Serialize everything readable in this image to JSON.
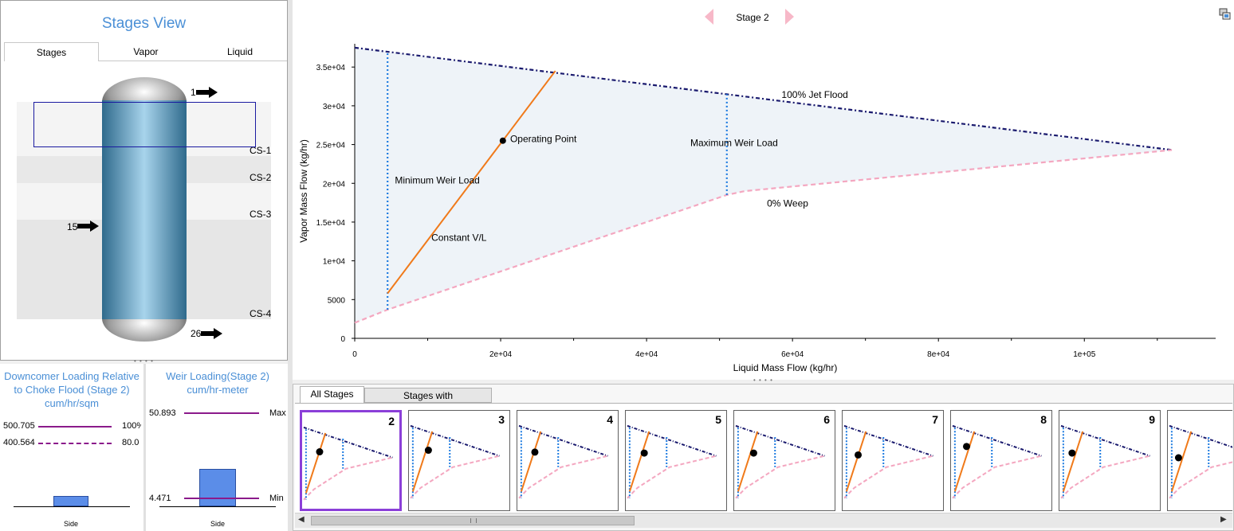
{
  "stages_view": {
    "title": "Stages View",
    "tabs": [
      "Stages",
      "Vapor",
      "Liquid"
    ],
    "active_tab": "Stages",
    "column_sections": [
      "CS-1",
      "CS-2",
      "CS-3",
      "CS-4"
    ],
    "streams": [
      "1",
      "15",
      "26"
    ]
  },
  "downcomer": {
    "title_line1": "Downcomer Loading Relative",
    "title_line2": "to Choke Flood (Stage 2)",
    "units": "cum/hr/sqm",
    "line1_value": "500.705",
    "line1_pct": "100%",
    "line2_value": "400.564",
    "line2_pct": "80.0",
    "bar_label": "Side"
  },
  "weir": {
    "title_line1": "Weir Loading(Stage 2)",
    "units": "cum/hr-meter",
    "max_value": "50.893",
    "max_label": "Max",
    "min_value": "4.471",
    "min_label": "Min",
    "bar_label": "Side"
  },
  "stage_nav": {
    "label": "Stage 2"
  },
  "chart_data": {
    "type": "line",
    "xlabel": "Liquid Mass Flow (kg/hr)",
    "ylabel": "Vapor Mass Flow (kg/hr)",
    "xlim": [
      0,
      118000
    ],
    "ylim": [
      0,
      38000
    ],
    "x_ticks": [
      0,
      20000,
      40000,
      60000,
      80000,
      100000
    ],
    "x_tick_labels": [
      "0",
      "2e+04",
      "4e+04",
      "6e+04",
      "8e+04",
      "1e+05"
    ],
    "y_ticks": [
      0,
      5000,
      10000,
      15000,
      20000,
      25000,
      30000,
      35000
    ],
    "y_tick_labels": [
      "0",
      "5000",
      "1e+04",
      "1.5e+04",
      "2e+04",
      "2.5e+04",
      "3e+04",
      "3.5e+04"
    ],
    "series": [
      {
        "name": "100% Jet Flood",
        "x": [
          0,
          112000
        ],
        "y": [
          37500,
          24300
        ],
        "color": "#1a1a6e",
        "dash": "dotdash"
      },
      {
        "name": "0% Weep",
        "x": [
          0,
          4500,
          51000,
          53500,
          112000
        ],
        "y": [
          2000,
          3700,
          18500,
          19000,
          24300
        ],
        "color": "#f4a7c0",
        "dash": "dash"
      },
      {
        "name": "Minimum Weir Load",
        "x": [
          4500,
          4500
        ],
        "y": [
          3700,
          37000
        ],
        "color": "#1e7be0",
        "dash": "dot"
      },
      {
        "name": "Maximum Weir Load",
        "x": [
          51000,
          51000
        ],
        "y": [
          18500,
          31500
        ],
        "color": "#1e7be0",
        "dash": "dot"
      },
      {
        "name": "Constant V/L",
        "x": [
          4500,
          27500
        ],
        "y": [
          5800,
          34500
        ],
        "color": "#f07a1a",
        "dash": "solid"
      }
    ],
    "operating_point": {
      "name": "Operating Point",
      "x": 20300,
      "y": 25500
    },
    "annotations": [
      {
        "text": "100% Jet Flood",
        "x": 58500,
        "y": 31000
      },
      {
        "text": "Maximum Weir Load",
        "x": 46000,
        "y": 24800
      },
      {
        "text": "0% Weep",
        "x": 56500,
        "y": 17000
      },
      {
        "text": "Minimum Weir Load",
        "x": 5500,
        "y": 20000
      },
      {
        "text": "Constant V/L",
        "x": 10500,
        "y": 12600
      },
      {
        "text": "Operating Point",
        "x": 21300,
        "y": 25300
      }
    ],
    "grid": false
  },
  "bottom": {
    "tabs": [
      "All Stages",
      "Stages with Errors/Warnings"
    ],
    "active_tab": "All Stages",
    "stages": [
      "2",
      "3",
      "4",
      "5",
      "6",
      "7",
      "8",
      "9",
      ""
    ],
    "selected_stage": "2",
    "thumb_points": [
      [
        0.18,
        0.42
      ],
      [
        0.2,
        0.42
      ],
      [
        0.18,
        0.44
      ],
      [
        0.19,
        0.45
      ],
      [
        0.2,
        0.45
      ],
      [
        0.16,
        0.47
      ],
      [
        0.16,
        0.38
      ],
      [
        0.13,
        0.45
      ],
      [
        0.11,
        0.5
      ]
    ]
  }
}
